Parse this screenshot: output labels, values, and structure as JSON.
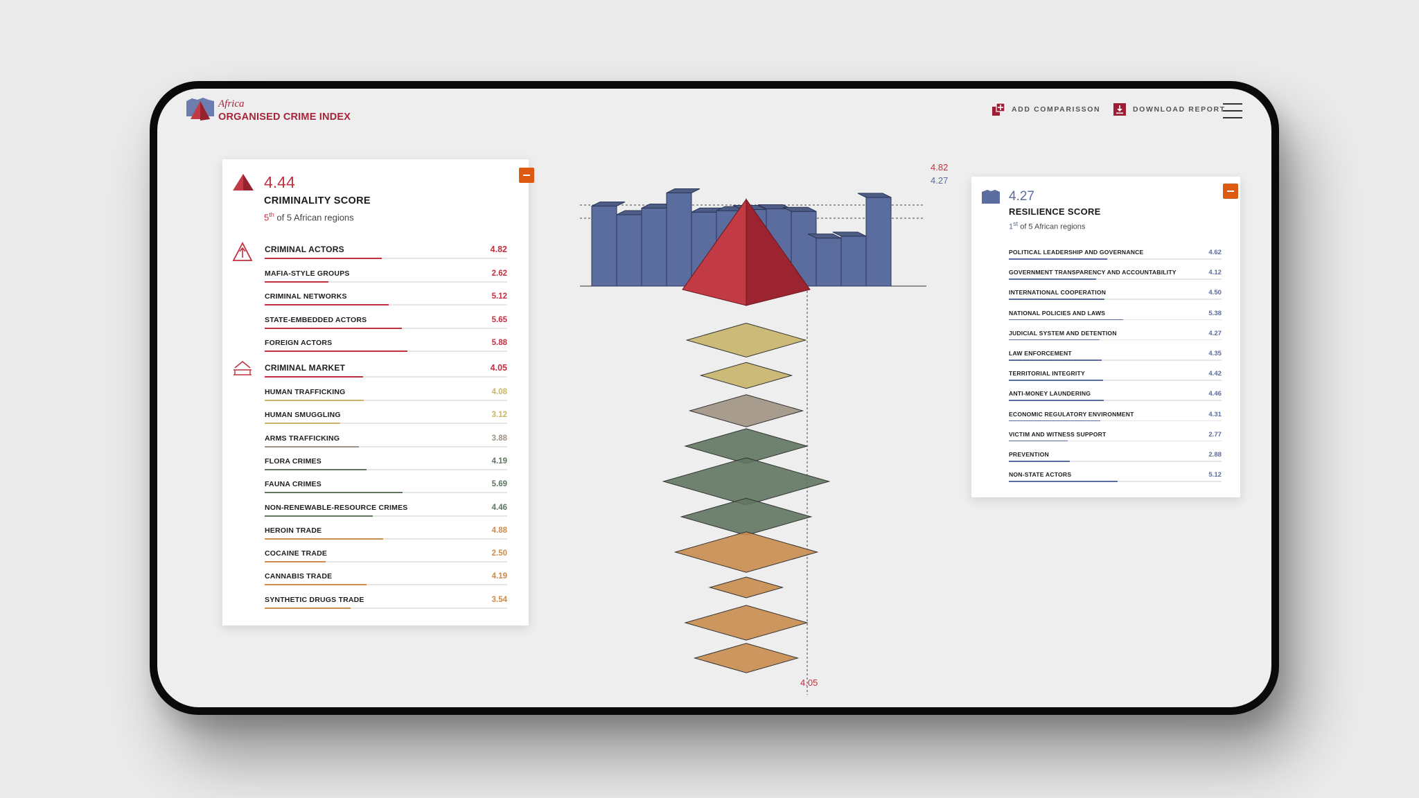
{
  "header": {
    "logo_line1": "Africa",
    "logo_line2": "ORGANISED CRIME INDEX",
    "add_comparison": "ADD COMPARISSON",
    "download_report": "DOWNLOAD REPORT"
  },
  "colors": {
    "criminality": "#b8313e",
    "resilience": "#5b6d9e",
    "actors": "#c0303f",
    "market_human": "#c8b46a",
    "market_arms": "#9e9282",
    "market_environment": "#5f7560",
    "market_drugs": "#c98c4e",
    "collapse": "#dc5a12"
  },
  "criminality": {
    "score": "4.44",
    "title": "CRIMINALITY SCORE",
    "rank_pos": "5",
    "rank_sup": "th",
    "rank_text": "of 5 African regions",
    "actors": {
      "label": "CRIMINAL ACTORS",
      "value": "4.82",
      "items": [
        {
          "label": "MAFIA-STYLE GROUPS",
          "value": "2.62"
        },
        {
          "label": "CRIMINAL NETWORKS",
          "value": "5.12"
        },
        {
          "label": "STATE-EMBEDDED ACTORS",
          "value": "5.65"
        },
        {
          "label": "FOREIGN ACTORS",
          "value": "5.88"
        }
      ]
    },
    "markets": {
      "label": "CRIMINAL MARKET",
      "value": "4.05",
      "items": [
        {
          "label": "HUMAN TRAFFICKING",
          "value": "4.08",
          "group": "human"
        },
        {
          "label": "HUMAN SMUGGLING",
          "value": "3.12",
          "group": "human"
        },
        {
          "label": "ARMS TRAFFICKING",
          "value": "3.88",
          "group": "arms"
        },
        {
          "label": "FLORA CRIMES",
          "value": "4.19",
          "group": "environment"
        },
        {
          "label": "FAUNA CRIMES",
          "value": "5.69",
          "group": "environment"
        },
        {
          "label": "NON-RENEWABLE-RESOURCE CRIMES",
          "value": "4.46",
          "group": "environment"
        },
        {
          "label": "HEROIN TRADE",
          "value": "4.88",
          "group": "drugs"
        },
        {
          "label": "COCAINE TRADE",
          "value": "2.50",
          "group": "drugs"
        },
        {
          "label": "CANNABIS TRADE",
          "value": "4.19",
          "group": "drugs"
        },
        {
          "label": "SYNTHETIC DRUGS TRADE",
          "value": "3.54",
          "group": "drugs"
        }
      ]
    }
  },
  "resilience": {
    "score": "4.27",
    "title": "RESILIENCE SCORE",
    "rank_pos": "1",
    "rank_sup": "st",
    "rank_text": "of 5 African regions",
    "items": [
      {
        "label": "POLITICAL LEADERSHIP AND GOVERNANCE",
        "value": "4.62"
      },
      {
        "label": "GOVERNMENT TRANSPARENCY AND ACCOUNTABILITY",
        "value": "4.12"
      },
      {
        "label": "INTERNATIONAL COOPERATION",
        "value": "4.50"
      },
      {
        "label": "NATIONAL POLICIES AND LAWS",
        "value": "5.38"
      },
      {
        "label": "JUDICIAL SYSTEM AND DETENTION",
        "value": "4.27"
      },
      {
        "label": "LAW ENFORCEMENT",
        "value": "4.35"
      },
      {
        "label": "TERRITORIAL INTEGRITY",
        "value": "4.42"
      },
      {
        "label": "ANTI-MONEY LAUNDERING",
        "value": "4.46"
      },
      {
        "label": "ECONOMIC REGULATORY ENVIRONMENT",
        "value": "4.31"
      },
      {
        "label": "VICTIM AND WITNESS SUPPORT",
        "value": "2.77"
      },
      {
        "label": "PREVENTION",
        "value": "2.88"
      },
      {
        "label": "NON-STATE ACTORS",
        "value": "5.12"
      }
    ]
  },
  "viz": {
    "annotation_actors": "4.82",
    "annotation_resilience": "4.27",
    "annotation_markets": "4.05",
    "max_score": 10
  }
}
